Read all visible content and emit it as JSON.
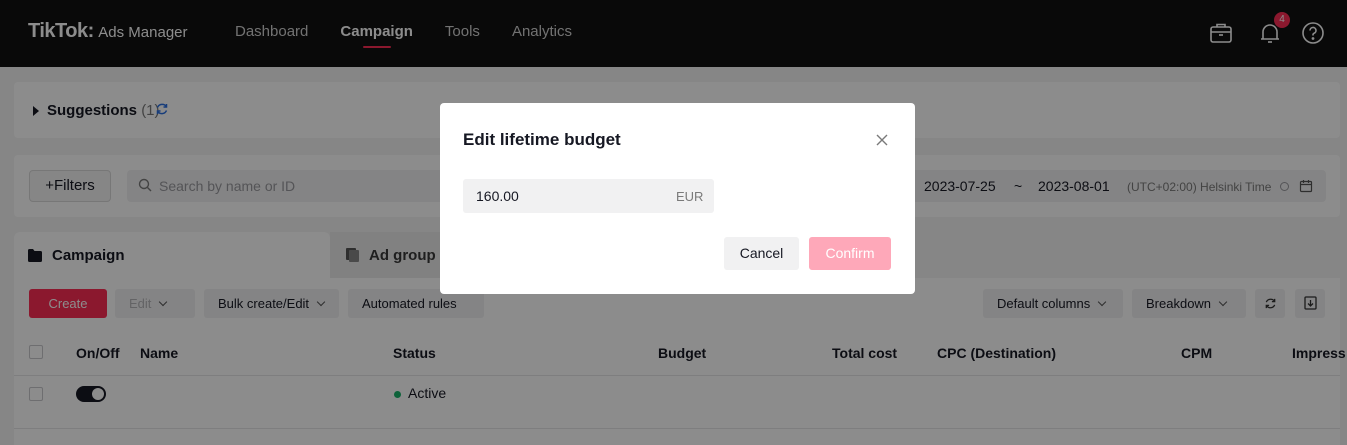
{
  "header": {
    "logo_main": "TikTok",
    "logo_sep": ":",
    "logo_sub": "Ads Manager",
    "nav": [
      {
        "label": "Dashboard"
      },
      {
        "label": "Campaign"
      },
      {
        "label": "Tools"
      },
      {
        "label": "Analytics"
      }
    ],
    "active_nav": "Campaign",
    "notification_count": "4",
    "icons": [
      "briefcase-icon",
      "bell-icon",
      "help-icon"
    ]
  },
  "suggestions": {
    "label": "Suggestions",
    "count": "(1)"
  },
  "filters": {
    "filters_label": "+Filters",
    "search_placeholder": "Search by name or ID",
    "date_start": "2023-07-25",
    "date_sep": "~",
    "date_end": "2023-08-01",
    "timezone": "(UTC+02:00) Helsinki Time"
  },
  "tabs": {
    "campaign": "Campaign",
    "ad_group": "Ad group"
  },
  "toolbar": {
    "create": "Create",
    "edit": "Edit",
    "bulk": "Bulk create/Edit",
    "rules": "Automated rules",
    "columns": "Default columns",
    "breakdown": "Breakdown"
  },
  "table": {
    "headers": {
      "onoff": "On/Off",
      "name": "Name",
      "status": "Status",
      "budget": "Budget",
      "total_cost": "Total cost",
      "cpc": "CPC (Destination)",
      "cpm": "CPM",
      "impressions": "Impress"
    },
    "rows": [
      {
        "status": "Active",
        "enabled": true
      }
    ]
  },
  "modal": {
    "title": "Edit lifetime budget",
    "budget_value": "160.00",
    "currency": "EUR",
    "cancel": "Cancel",
    "confirm": "Confirm"
  },
  "colors": {
    "brand": "#fe2c55",
    "confirm_disabled": "#fea8b9",
    "status_active": "#1ab26b",
    "topbar": "#121212"
  }
}
